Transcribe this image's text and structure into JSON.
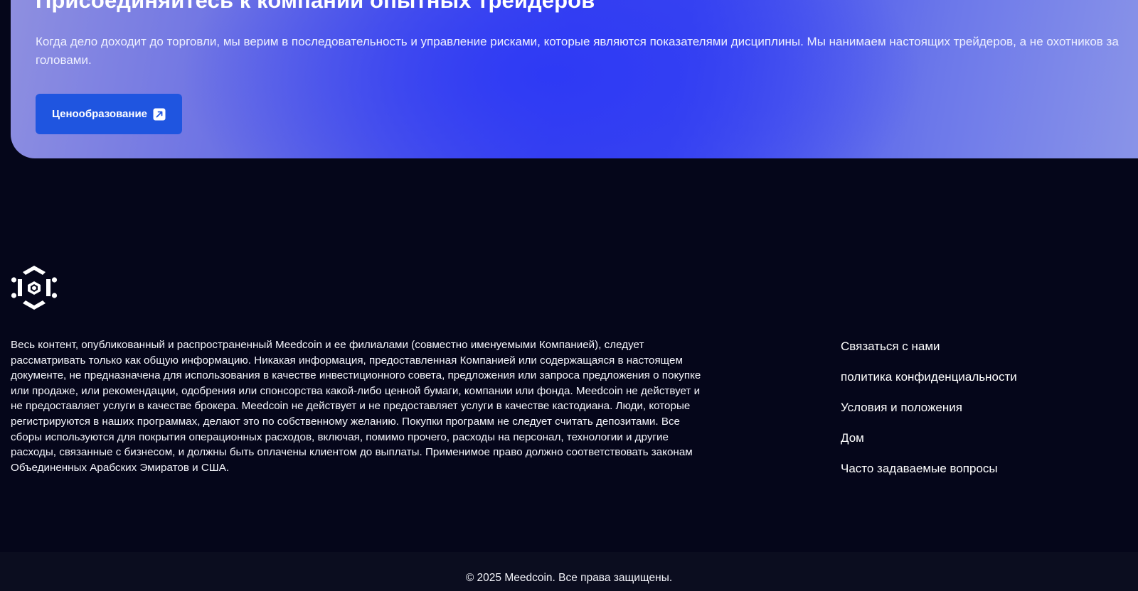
{
  "cta": {
    "title": "Присоединяйтесь к компании опытных трейдеров",
    "text": "Когда дело доходит до торговли, мы верим в последовательность и управление рисками, которые являются показателями дисциплины. Мы нанимаем настоящих трейдеров, а не охотников за головами.",
    "button_label": "Ценообразование",
    "button_icon": "arrow-up-right-icon"
  },
  "footer": {
    "logo_icon": "hexagon-logo-icon",
    "disclaimer": "Весь контент, опубликованный и распространенный Meedcoin и ее филиалами (совместно именуемыми Компанией), следует рассматривать только как общую информацию. Никакая информация, предоставленная Компанией или содержащаяся в настоящем документе, не предназначена для использования в качестве инвестиционного совета, предложения или запроса предложения о покупке или продаже, или рекомендации, одобрения или спонсорства какой-либо ценной бумаги, компании или фонда. Meedcoin не действует и не предоставляет услуги в качестве брокера. Meedcoin не действует и не предоставляет услуги в качестве кастодиана. Люди, которые регистрируются в наших программах, делают это по собственному желанию. Покупки программ не следует считать депозитами. Все сборы используются для покрытия операционных расходов, включая, помимо прочего, расходы на персонал, технологии и другие расходы, связанные с бизнесом, и должны быть оплачены клиентом до выплаты. Применимое право должно соответствовать законам Объединенных Арабских Эмиратов и США.",
    "links": [
      {
        "label": "Связаться с нами"
      },
      {
        "label": "политика конфиденциальности"
      },
      {
        "label": "Условия и положения"
      },
      {
        "label": "Дом"
      },
      {
        "label": "Часто задаваемые вопросы"
      }
    ],
    "copyright": "© 2025 Meedcoin. Все права защищены."
  },
  "colors": {
    "page_background": "#05061a",
    "bottom_bar": "#0b0d1f",
    "button": "#1f55e0",
    "banner_accent": "#3a43ee"
  }
}
